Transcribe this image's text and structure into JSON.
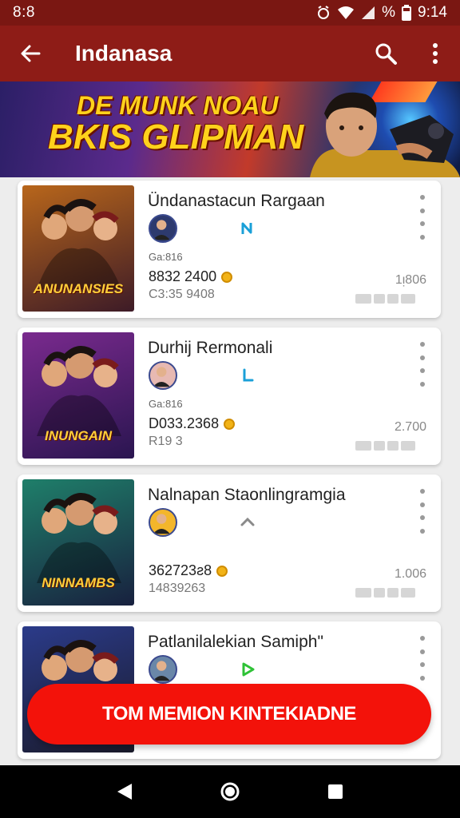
{
  "status_bar": {
    "time_left": "8:8",
    "battery_text": "%",
    "time_right": "9:14"
  },
  "app_bar": {
    "title": "Indanasa",
    "icons": [
      "back-arrow-icon",
      "search-icon",
      "more-vertical-icon"
    ]
  },
  "banner": {
    "line1": "DE MUNK NOAU",
    "line2": "BKIS GLIPMAN"
  },
  "items": [
    {
      "title": "Ündanastacun Rargaan",
      "thumb_text": "ANUNANSIES",
      "thumb_colors": [
        "#b8661b",
        "#3d1b27"
      ],
      "small": "Ga:816",
      "value": "8832 2400",
      "sub": "C3:35 9408",
      "right_num": "1ᴉ806",
      "tag_icon": "n-badge-icon",
      "tag_color": "#1aa0d8"
    },
    {
      "title": "Durhij Rermonali",
      "thumb_text": "INUNGAIN",
      "thumb_colors": [
        "#7a2a8e",
        "#2a1550"
      ],
      "small": "Ga:816",
      "value": "D033.2368",
      "sub": "R19 3",
      "right_num": "2.700",
      "tag_icon": "l-badge-icon",
      "tag_color": "#1aa0d8"
    },
    {
      "title": "Nalnapan Staonlingramgia",
      "thumb_text": "NINNAMBS",
      "thumb_colors": [
        "#1f7f6a",
        "#18203e"
      ],
      "small": "",
      "value": "362723ƨ8",
      "sub": "14839263",
      "right_num": "1.006",
      "tag_icon": "chevron-up-icon",
      "tag_color": "#8a8a8a"
    },
    {
      "title": "Patlanilalekian Samiph\"",
      "thumb_text": "",
      "thumb_colors": [
        "#2b3b8a",
        "#1a1a2a"
      ],
      "small": "",
      "value": "",
      "sub": "",
      "right_num": "",
      "tag_icon": "play-badge-icon",
      "tag_color": "#2ec236"
    }
  ],
  "fab": {
    "label": "TOM MEMION KINTEKIADNE"
  },
  "nav_bar": {
    "icons": [
      "back-triangle-icon",
      "home-circle-icon",
      "recents-square-icon"
    ]
  },
  "colors": {
    "app_bar": "#8e1c17",
    "status_bar": "#7a1712",
    "fab": "#f3120a",
    "banner_text": "#ffd21c"
  }
}
